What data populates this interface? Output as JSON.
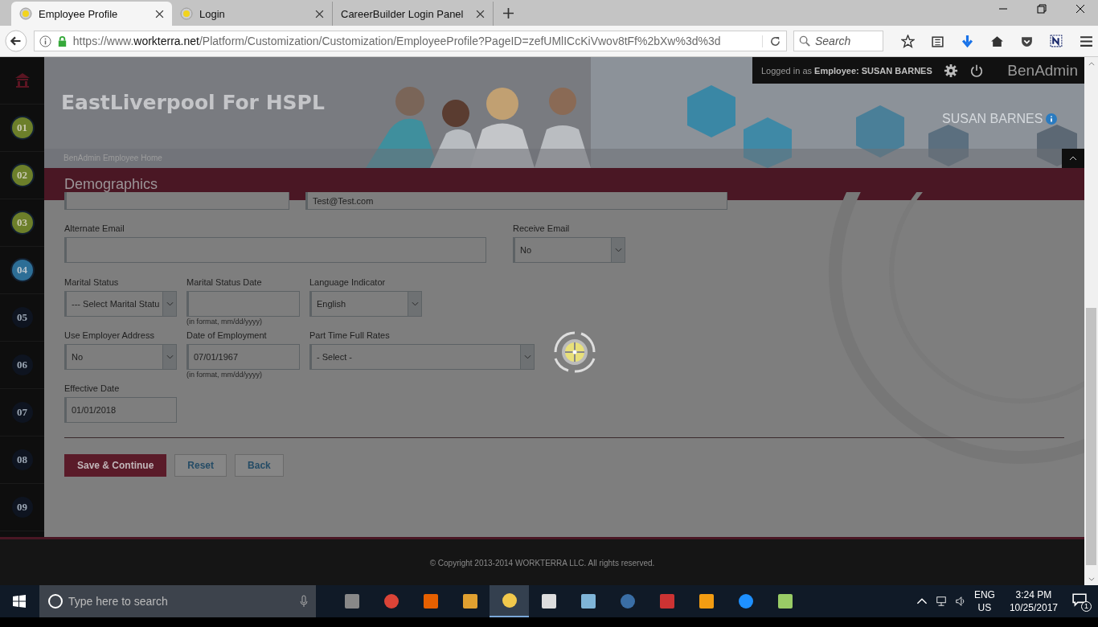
{
  "browser": {
    "tabs": [
      {
        "title": "Employee Profile",
        "selected": true,
        "kind": "site"
      },
      {
        "title": "Login",
        "selected": false,
        "kind": "site"
      },
      {
        "title": "CareerBuilder Login Panel",
        "selected": false,
        "kind": "plain"
      }
    ],
    "url": {
      "prefix": "https://www.",
      "host": "workterra.net",
      "path": "/Platform/Customization/Customization/EmployeeProfile?PageID=zefUMlICcKiVwov8tFf%2bXw%3d%3d"
    },
    "search": {
      "placeholder": "Search"
    }
  },
  "sidebar": {
    "steps": [
      {
        "label": "01",
        "completed": true,
        "selected": false
      },
      {
        "label": "02",
        "completed": true,
        "selected": false
      },
      {
        "label": "03",
        "completed": true,
        "selected": false
      },
      {
        "label": "04",
        "completed": false,
        "selected": true
      },
      {
        "label": "05",
        "completed": false,
        "selected": false
      },
      {
        "label": "06",
        "completed": false,
        "selected": false
      },
      {
        "label": "07",
        "completed": false,
        "selected": false
      },
      {
        "label": "08",
        "completed": false,
        "selected": false
      },
      {
        "label": "09",
        "completed": false,
        "selected": false
      }
    ]
  },
  "header": {
    "site_title": "EastLiverpool For HSPL",
    "logged_in": "Logged in as **Employee:  SUSAN BARNES**",
    "app_name": "BenAdmin",
    "user_name": "SUSAN BARNES",
    "breadcrumb": "BenAdmin Employee Home"
  },
  "section_title": "Demographics",
  "form": {
    "fields": [
      {
        "kind": "text"
      },
      {
        "kind": "text",
        "value": "Test@Test.com"
      },
      {
        "kind": "text",
        "label": "Alternate Email"
      },
      {
        "kind": "select",
        "label": "Receive Email",
        "value": "No"
      },
      {
        "kind": "select",
        "label": "Marital Status",
        "value": "--- Select Marital Statu"
      },
      {
        "kind": "text",
        "label": "Marital Status Date",
        "hint": "(in format, mm/dd/yyyy)"
      },
      {
        "kind": "select",
        "label": "Language Indicator",
        "value": "English"
      },
      {
        "kind": "select",
        "label": "Use Employer Address",
        "value": "No"
      },
      {
        "kind": "text",
        "label": "Date of Employment",
        "value": "07/01/1967",
        "hint": "(in format, mm/dd/yyyy)"
      },
      {
        "kind": "select",
        "label": "Part Time Full Rates",
        "value": "- Select -"
      },
      {
        "kind": "text",
        "label": "Effective Date",
        "value": "01/01/2018"
      }
    ],
    "buttons": [
      {
        "label": "Save & Continue",
        "kind": "primary"
      },
      {
        "label": "Reset",
        "kind": "secondary"
      },
      {
        "label": "Back",
        "kind": "secondary"
      }
    ]
  },
  "footer": {
    "copyright": "© Copyright 2013-2014 WORKTERRA LLC. All rights reserved."
  },
  "taskbar": {
    "search_placeholder": "Type here to search",
    "language": "ENG",
    "region": "US",
    "time": "3:24 PM",
    "date": "10/25/2017",
    "notifications": "1"
  }
}
